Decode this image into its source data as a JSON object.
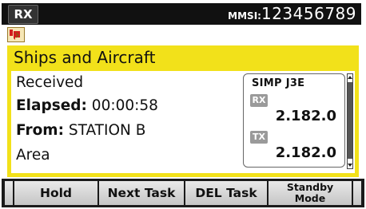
{
  "status": {
    "mode": "RX",
    "mmsi_label": "MMSI:",
    "mmsi_value": "123456789"
  },
  "panel": {
    "title": "Ships and Aircraft",
    "lines": {
      "received": "Received",
      "elapsed_label": "Elapsed:",
      "elapsed_value": "00:00:58",
      "from_label": "From:",
      "from_value": "STATION B",
      "area": "Area"
    },
    "channel": {
      "mode": "SIMP J3E",
      "rx_badge": "RX",
      "rx_freq": "2.182.0",
      "tx_badge": "TX",
      "tx_freq": "2.182.0"
    }
  },
  "softkeys": {
    "hold": "Hold",
    "next_task": "Next Task",
    "del_task": "DEL Task",
    "standby_line1": "Standby",
    "standby_line2": "Mode"
  },
  "colors": {
    "panel_yellow": "#f2e11a",
    "topbar": "#111111",
    "softkey_bg": "#d6d6d6"
  }
}
